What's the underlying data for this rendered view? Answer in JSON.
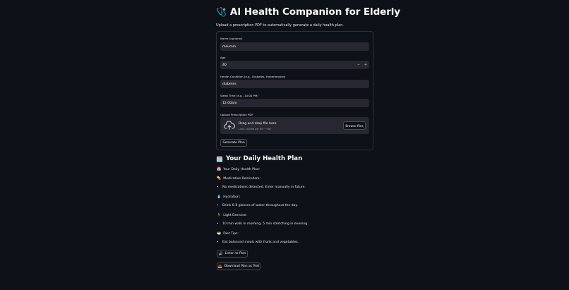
{
  "header": {
    "title_emoji": "🩺",
    "title": "AI Health Companion for Elderly",
    "subtitle": "Upload a prescription PDF to automatically generate a daily health plan."
  },
  "form": {
    "name": {
      "label": "Name (optional)",
      "value": "moumm"
    },
    "age": {
      "label": "Age",
      "value": "40",
      "minus": "−",
      "plus": "+"
    },
    "condition": {
      "label": "Health Condition (e.g., Diabetes, Hypertension)",
      "value": "diabetes"
    },
    "sleep": {
      "label": "Sleep Time (e.g., 10:00 PM)",
      "value": "12.00am"
    },
    "upload": {
      "label": "Upload Prescription PDF",
      "drag_text": "Drag and drop file here",
      "limit_text": "Limit 200MB per file • PDF",
      "browse_label": "Browse files",
      "icon": "cloud-upload-icon"
    },
    "generate_label": "Generate Plan"
  },
  "plan": {
    "heading_emoji": "🗓️",
    "heading": "Your Daily Health Plan",
    "intro_emoji": "📅",
    "intro": "Your Daily Health Plan:",
    "medication": {
      "emoji": "💊",
      "label": "Medication Reminders:",
      "item": "No medications detected. Enter manually in future."
    },
    "hydration": {
      "emoji": "💧",
      "label": "Hydration:",
      "item": "Drink 6-8 glasses of water throughout the day."
    },
    "exercise": {
      "emoji": "🏃",
      "label": "Light Exercise:",
      "item": "10 min walk in morning, 5 min stretching in evening."
    },
    "diet": {
      "emoji": "🥗",
      "label": "Diet Tips:",
      "item": "Eat balanced meals with fruits and vegetables."
    },
    "listen": {
      "emoji": "🔊",
      "label": "Listen to Plan"
    },
    "download": {
      "emoji": "📥",
      "label": "Download Plan as Text"
    }
  },
  "colors": {
    "background": "#0e1117",
    "input_bg": "#262730",
    "border": "#2f323c",
    "text": "#fafafa"
  }
}
